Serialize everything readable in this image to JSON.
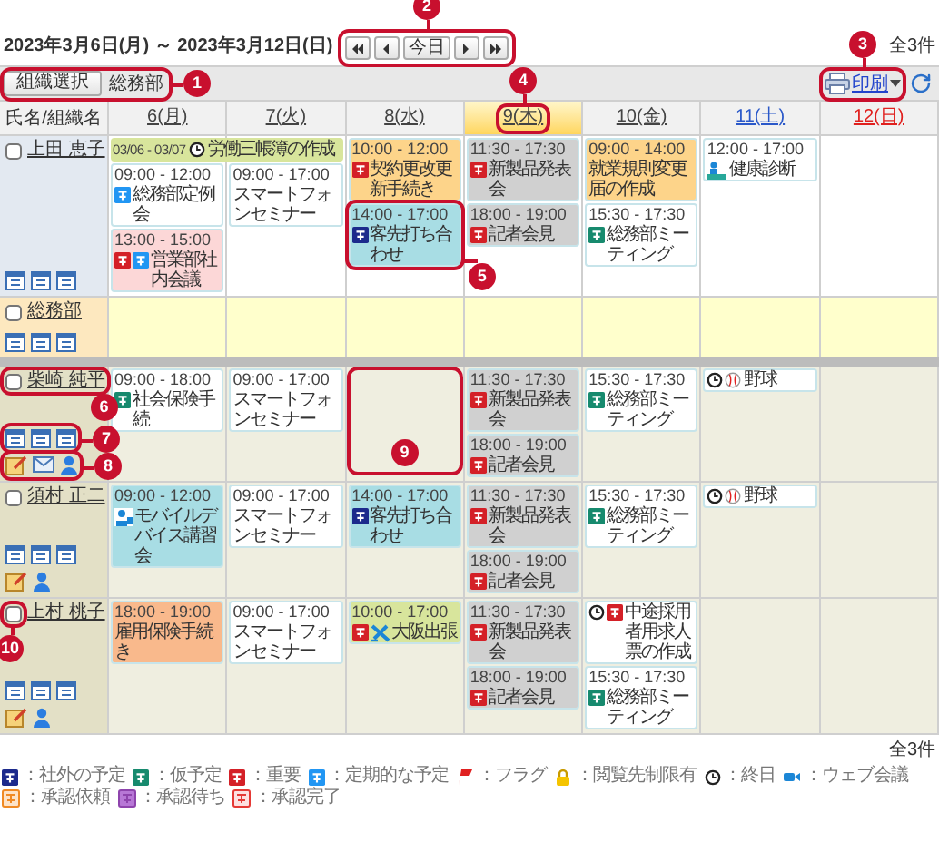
{
  "header": {
    "date_range": "2023年3月6日(月) ～ 2023年3月12日(日)",
    "nav": {
      "callout": "2",
      "buttons": [
        {
          "kind": "first"
        },
        {
          "kind": "prev"
        },
        {
          "kind": "today",
          "label": "今日"
        },
        {
          "kind": "next"
        },
        {
          "kind": "last"
        }
      ]
    },
    "count": "全3件"
  },
  "toolbar": {
    "org_button": "組織選択",
    "org_name": "総務部",
    "callout": "1",
    "print": {
      "label": "印刷",
      "callout": "3"
    }
  },
  "columns": {
    "name_header": "氏名/組織名",
    "days": [
      {
        "label": "6(月)",
        "kind": "weekday",
        "today": false
      },
      {
        "label": "7(火)",
        "kind": "weekday",
        "today": false
      },
      {
        "label": "8(水)",
        "kind": "weekday",
        "today": false
      },
      {
        "label": "9(木)",
        "kind": "weekday",
        "today": true,
        "callout": "4"
      },
      {
        "label": "10(金)",
        "kind": "weekday",
        "today": false
      },
      {
        "label": "11(土)",
        "kind": "saturday",
        "today": false
      },
      {
        "label": "12(日)",
        "kind": "sunday",
        "today": false
      }
    ]
  },
  "rows": [
    {
      "kind": "member",
      "self": true,
      "name": "上田 恵子",
      "checked": false,
      "days": [
        {
          "banner": {
            "dates": "03/06 - 03/07",
            "icons": [
              {
                "kind": "allday"
              }
            ],
            "title": "労働三帳簿の作成",
            "color": "#d8e59c",
            "continues": true
          },
          "events": [
            {
              "time": "09:00 - 12:00",
              "icons": [
                {
                  "kind": "regular"
                }
              ],
              "title": "総務部定例会",
              "color": "#ffffff"
            },
            {
              "time": "13:00 - 15:00",
              "icons": [
                {
                  "kind": "important"
                },
                {
                  "kind": "regular"
                }
              ],
              "title": "営業部社内会議",
              "color": "#fcd7d7"
            }
          ]
        },
        {
          "events": [
            {
              "time": "09:00 - 17:00",
              "title": "スマートフォンセミナー",
              "color": "#ffffff"
            }
          ]
        },
        {
          "events": [
            {
              "time": "10:00 - 12:00",
              "icons": [
                {
                  "kind": "important"
                }
              ],
              "title": "契約更改更新手続き",
              "color": "#fdd48a"
            },
            {
              "time": "14:00 - 17:00",
              "icons": [
                {
                  "kind": "out"
                }
              ],
              "title": "客先打ち合わせ",
              "color": "#a8dde4",
              "callout": "5"
            }
          ]
        },
        {
          "events": [
            {
              "time": "11:30 - 17:30",
              "icons": [
                {
                  "kind": "important"
                }
              ],
              "title": "新製品発表会",
              "color": "#d0d0d0"
            },
            {
              "time": "18:00 - 19:00",
              "icons": [
                {
                  "kind": "important"
                }
              ],
              "title": "記者会見",
              "color": "#d0d0d0"
            }
          ]
        },
        {
          "events": [
            {
              "time": "09:00 - 14:00",
              "title": "就業規則変更届の作成",
              "color": "#fdd48a"
            },
            {
              "time": "15:30 - 17:30",
              "icons": [
                {
                  "kind": "tentative"
                }
              ],
              "title": "総務部ミーティング",
              "color": "#ffffff"
            }
          ]
        },
        {
          "events": [
            {
              "time": "12:00 - 17:00",
              "icons": [
                {
                  "kind": "health"
                }
              ],
              "title": "健康診断",
              "color": "#ffffff"
            }
          ]
        }
      ]
    },
    {
      "kind": "group",
      "name": "総務部",
      "checked": false
    },
    {
      "kind": "member",
      "self": false,
      "name": "柴崎 純平",
      "checked": false,
      "name_callout": "6",
      "calendar_callout": "7",
      "actions": [
        {
          "kind": "memo"
        },
        {
          "kind": "mail"
        },
        {
          "kind": "profile"
        }
      ],
      "actions_callout": "8",
      "days": [
        {
          "events": [
            {
              "time": "09:00 - 18:00",
              "icons": [
                {
                  "kind": "tentative"
                }
              ],
              "title": "社会保険手続",
              "color": "#ffffff"
            }
          ]
        },
        {
          "events": [
            {
              "time": "09:00 - 17:00",
              "title": "スマートフォンセミナー",
              "color": "#ffffff"
            }
          ]
        },
        {
          "callout": "9"
        },
        {
          "events": [
            {
              "time": "11:30 - 17:30",
              "icons": [
                {
                  "kind": "important"
                }
              ],
              "title": "新製品発表会",
              "color": "#d0d0d0"
            },
            {
              "time": "18:00 - 19:00",
              "icons": [
                {
                  "kind": "important"
                }
              ],
              "title": "記者会見",
              "color": "#d0d0d0"
            }
          ]
        },
        {
          "events": [
            {
              "time": "15:30 - 17:30",
              "icons": [
                {
                  "kind": "tentative"
                }
              ],
              "title": "総務部ミーティング",
              "color": "#ffffff"
            }
          ]
        },
        {
          "events": [
            {
              "icons": [
                {
                  "kind": "allday"
                },
                {
                  "kind": "baseball"
                }
              ],
              "title": "野球",
              "color": "#ffffff"
            }
          ]
        }
      ]
    },
    {
      "kind": "member",
      "self": false,
      "name": "須村 正二",
      "checked": false,
      "actions": [
        {
          "kind": "memo"
        },
        {
          "kind": "profile"
        }
      ],
      "days": [
        {
          "events": [
            {
              "time": "09:00 - 12:00",
              "icons": [
                {
                  "kind": "device"
                }
              ],
              "title": "モバイルデバイス講習会",
              "color": "#a8dde4"
            }
          ]
        },
        {
          "events": [
            {
              "time": "09:00 - 17:00",
              "title": "スマートフォンセミナー",
              "color": "#ffffff"
            }
          ]
        },
        {
          "events": [
            {
              "time": "14:00 - 17:00",
              "icons": [
                {
                  "kind": "out"
                }
              ],
              "title": "客先打ち合わせ",
              "color": "#a8dde4"
            }
          ]
        },
        {
          "events": [
            {
              "time": "11:30 - 17:30",
              "icons": [
                {
                  "kind": "important"
                }
              ],
              "title": "新製品発表会",
              "color": "#d0d0d0"
            },
            {
              "time": "18:00 - 19:00",
              "icons": [
                {
                  "kind": "important"
                }
              ],
              "title": "記者会見",
              "color": "#d0d0d0"
            }
          ]
        },
        {
          "events": [
            {
              "time": "15:30 - 17:30",
              "icons": [
                {
                  "kind": "tentative"
                }
              ],
              "title": "総務部ミーティング",
              "color": "#ffffff"
            }
          ]
        },
        {
          "events": [
            {
              "icons": [
                {
                  "kind": "allday"
                },
                {
                  "kind": "baseball"
                }
              ],
              "title": "野球",
              "color": "#ffffff"
            }
          ]
        }
      ]
    },
    {
      "kind": "member",
      "self": false,
      "name": "上村 桃子",
      "checked": false,
      "checkbox_callout": "10",
      "actions": [
        {
          "kind": "memo"
        },
        {
          "kind": "profile"
        }
      ],
      "days": [
        {
          "events": [
            {
              "time": "18:00 - 19:00",
              "title": "雇用保険手続き",
              "color": "#f9b98c"
            }
          ]
        },
        {
          "events": [
            {
              "time": "09:00 - 17:00",
              "title": "スマートフォンセミナー",
              "color": "#ffffff"
            }
          ]
        },
        {
          "events": [
            {
              "time": "10:00 - 17:00",
              "icons": [
                {
                  "kind": "important"
                },
                {
                  "kind": "plane"
                }
              ],
              "title": "大阪出張",
              "color": "#d8e59c"
            }
          ]
        },
        {
          "events": [
            {
              "time": "11:30 - 17:30",
              "icons": [
                {
                  "kind": "important"
                }
              ],
              "title": "新製品発表会",
              "color": "#d0d0d0"
            },
            {
              "time": "18:00 - 19:00",
              "icons": [
                {
                  "kind": "important"
                }
              ],
              "title": "記者会見",
              "color": "#d0d0d0"
            }
          ]
        },
        {
          "events": [
            {
              "icons": [
                {
                  "kind": "allday"
                },
                {
                  "kind": "important"
                }
              ],
              "title": "中途採用者用求人票の作成",
              "color": "#ffffff"
            },
            {
              "time": "15:30 - 17:30",
              "icons": [
                {
                  "kind": "tentative"
                }
              ],
              "title": "総務部ミーティング",
              "color": "#ffffff"
            }
          ]
        }
      ]
    }
  ],
  "footer_count": "全3件",
  "legend": [
    {
      "kind": "out",
      "label": "：社外の予定"
    },
    {
      "kind": "tentative",
      "label": "：仮予定"
    },
    {
      "kind": "important",
      "label": "：重要"
    },
    {
      "kind": "regular",
      "label": "：定期的な予定"
    },
    {
      "kind": "flag",
      "label": "：フラグ"
    },
    {
      "kind": "lock",
      "label": "：閲覧先制限有"
    },
    {
      "kind": "allday",
      "label": "：終日"
    },
    {
      "kind": "web",
      "label": "：ウェブ会議"
    },
    {
      "kind": "approval-request",
      "label": "：承認依頼"
    },
    {
      "kind": "approval-wait",
      "label": "：承認待ち"
    },
    {
      "kind": "approval-done",
      "label": "：承認完了"
    }
  ]
}
